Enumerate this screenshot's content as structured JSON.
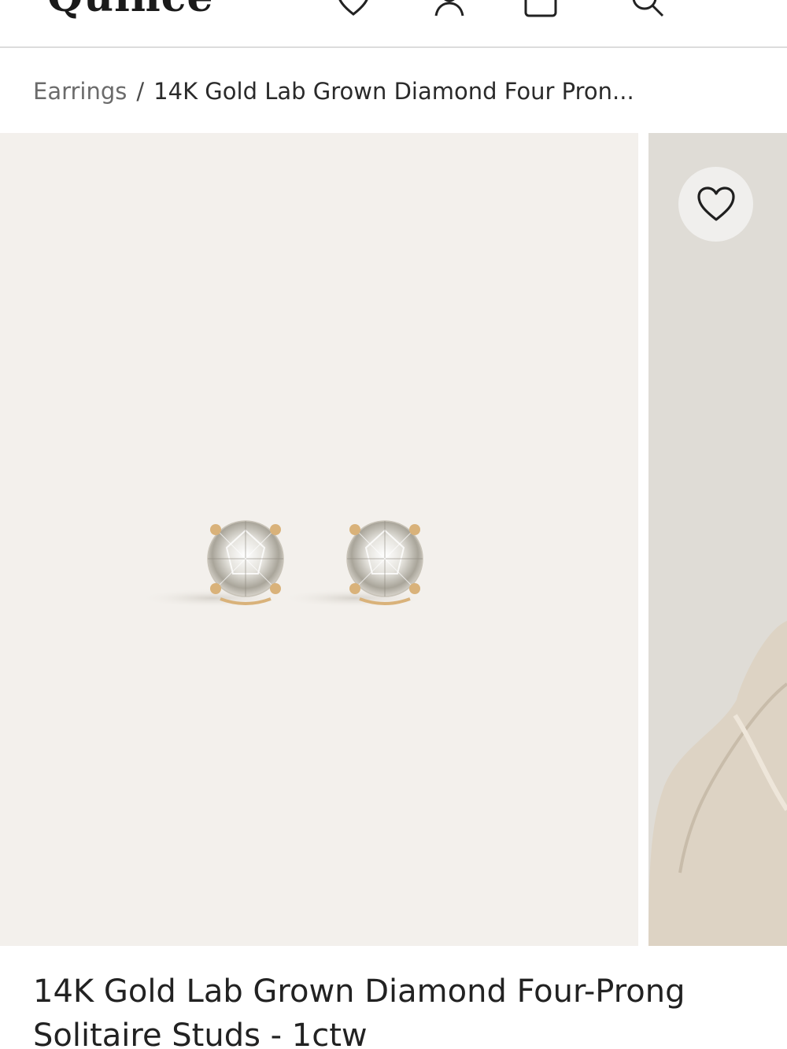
{
  "header": {
    "logo_text": "Quince",
    "icons": [
      "heart-icon",
      "account-icon",
      "bag-icon",
      "search-icon"
    ]
  },
  "breadcrumb": {
    "parent": "Earrings",
    "separator": "/",
    "current": "14K Gold Lab Grown Diamond Four Pron..."
  },
  "gallery": {
    "main_image": "diamond-stud-earrings-photo",
    "next_image": "model-wearing-earrings-photo",
    "wishlist_icon": "heart-icon"
  },
  "product": {
    "title_line1": "14K Gold Lab Grown Diamond Four-Prong",
    "title_line2": "Solitaire Studs - 1ctw"
  },
  "colors": {
    "image_background": "#f3f0ec",
    "gold": "#d9b27a",
    "divider": "#dcdcdc"
  }
}
